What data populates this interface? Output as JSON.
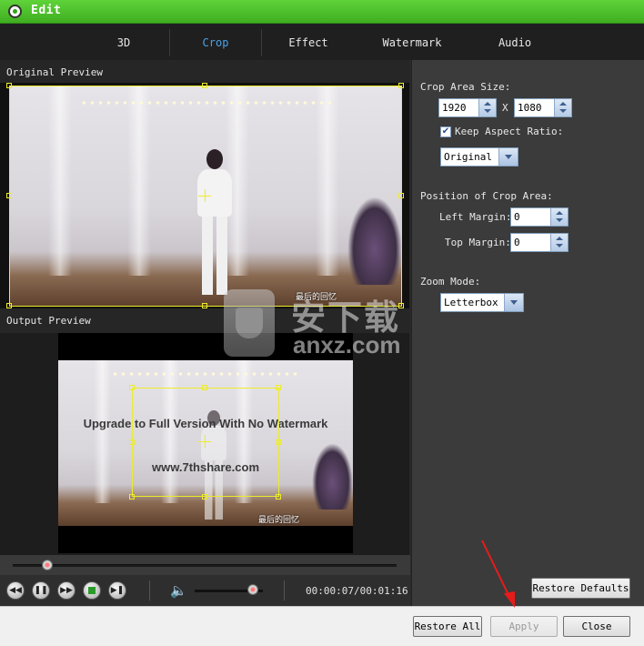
{
  "window": {
    "title": "Edit"
  },
  "tabs": [
    {
      "label": "3D",
      "active": false
    },
    {
      "label": "Crop",
      "active": true
    },
    {
      "label": "Effect",
      "active": false
    },
    {
      "label": "Watermark",
      "active": false
    },
    {
      "label": "Audio",
      "active": false
    }
  ],
  "preview": {
    "original_label": "Original Preview",
    "output_label": "Output Preview",
    "video_caption": "最后的回忆",
    "output_watermark_line1": "Upgrade to Full Version With No Watermark",
    "output_watermark_line2": "www.7thshare.com"
  },
  "playback": {
    "timecode": "00:00:07/00:01:16",
    "seek_fraction": 0.09,
    "volume_fraction": 0.85
  },
  "crop": {
    "area_size_label": "Crop Area Size:",
    "width": "1920",
    "separator": "X",
    "height": "1080",
    "keep_aspect_label": "Keep Aspect Ratio:",
    "keep_aspect_checked": true,
    "aspect_value": "Original",
    "position_label": "Position of Crop Area:",
    "left_margin_label": "Left Margin:",
    "left_margin": "0",
    "top_margin_label": "Top Margin:",
    "top_margin": "0",
    "zoom_label": "Zoom Mode:",
    "zoom_value": "Letterbox",
    "restore_defaults": "Restore Defaults"
  },
  "footer": {
    "restore_all": "Restore All",
    "apply": "Apply",
    "close": "Close"
  },
  "site_watermark": {
    "cn": "安下载",
    "domain": "anxz.com"
  },
  "colors": {
    "titlebar": "#3fae20",
    "active_tab": "#4aa3e8",
    "crop_box": "#ecec2a",
    "arrow": "#e81b1b"
  },
  "icons": {
    "rewind": "rewind-icon",
    "pause": "pause-icon",
    "forward": "fast-forward-icon",
    "stop": "stop-icon",
    "next": "next-frame-icon",
    "volume": "speaker-icon"
  }
}
